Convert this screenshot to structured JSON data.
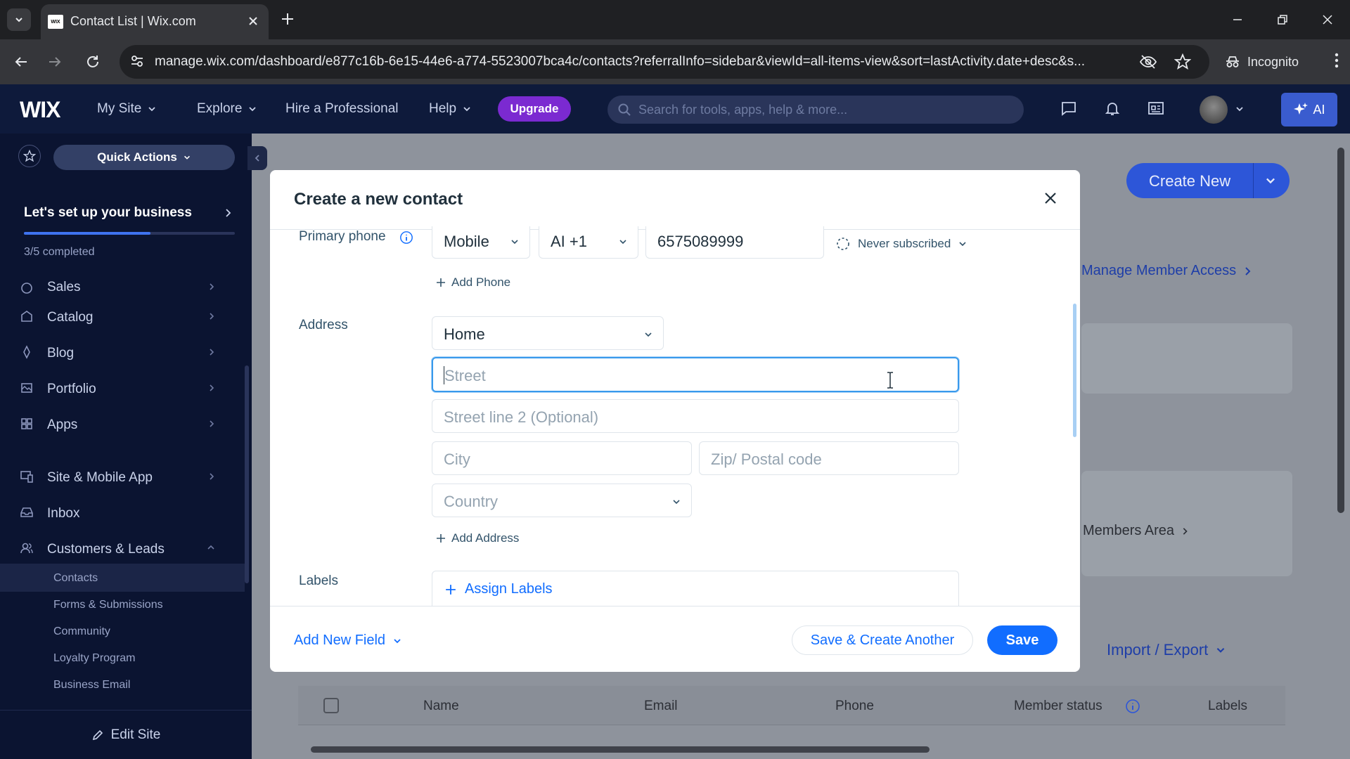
{
  "browser": {
    "tab_title": "Contact List | Wix.com",
    "tab_favicon": "WIX",
    "url": "manage.wix.com/dashboard/e877c16b-6e15-44e6-a774-5523007bca4c/contacts?referralInfo=sidebar&viewId=all-items-view&sort=lastActivity.date+desc&s...",
    "incognito_label": "Incognito"
  },
  "topbar": {
    "logo": "WIX",
    "my_site": "My Site",
    "explore": "Explore",
    "hire": "Hire a Professional",
    "help": "Help",
    "upgrade": "Upgrade",
    "search_placeholder": "Search for tools, apps, help & more...",
    "ai": "AI"
  },
  "sidebar": {
    "quick_actions": "Quick Actions",
    "setup_title": "Let's set up your business",
    "setup_progress_text": "3/5 completed",
    "setup_progress_value": 0.6,
    "items": [
      {
        "label": "Sales",
        "icon": "sales-icon"
      },
      {
        "label": "Catalog",
        "icon": "catalog-icon"
      },
      {
        "label": "Blog",
        "icon": "blog-icon"
      },
      {
        "label": "Portfolio",
        "icon": "portfolio-icon"
      },
      {
        "label": "Apps",
        "icon": "apps-icon"
      },
      {
        "label": "Site & Mobile App",
        "icon": "site-mobile-icon"
      },
      {
        "label": "Inbox",
        "icon": "inbox-icon"
      },
      {
        "label": "Customers & Leads",
        "icon": "customers-icon"
      }
    ],
    "subitems": [
      "Contacts",
      "Forms & Submissions",
      "Community",
      "Loyalty Program",
      "Business Email"
    ],
    "edit_site": "Edit Site"
  },
  "main": {
    "create_new": "Create New",
    "manage_member_access": "Manage Member Access",
    "members_area": "Members Area",
    "import_export": "Import / Export",
    "table_headers": [
      "Name",
      "Email",
      "Phone",
      "Member status",
      "Labels"
    ]
  },
  "modal": {
    "title": "Create a new contact",
    "primary_phone_label": "Primary phone",
    "phone_type": "Mobile",
    "country_code": "AI +1",
    "phone_number": "6575089999",
    "subscription_status": "Never subscribed",
    "add_phone": "Add Phone",
    "address_label": "Address",
    "address_type": "Home",
    "street_placeholder": "Street",
    "street2_placeholder": "Street line 2 (Optional)",
    "city_placeholder": "City",
    "zip_placeholder": "Zip/ Postal code",
    "country_placeholder": "Country",
    "add_address": "Add Address",
    "labels_label": "Labels",
    "assign_labels": "Assign Labels",
    "add_new_field": "Add New Field",
    "save_create_another": "Save & Create Another",
    "save": "Save"
  }
}
